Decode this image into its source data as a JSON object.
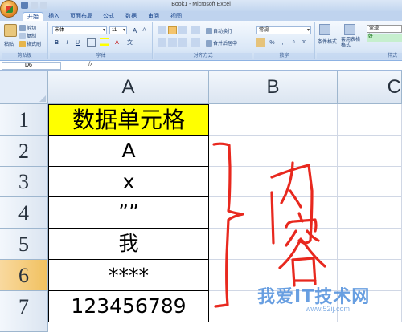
{
  "app": {
    "window_title": "Book1 - Microsoft Excel"
  },
  "tabs": [
    "开始",
    "插入",
    "页面布局",
    "公式",
    "数据",
    "审阅",
    "视图"
  ],
  "ribbon": {
    "clipboard": {
      "paste": "粘贴",
      "cut": "剪切",
      "copy": "复制",
      "format_painter": "格式刷",
      "label": "剪贴板"
    },
    "font": {
      "name": "宋体",
      "size": "11",
      "label": "字体",
      "bold": "B",
      "italic": "I",
      "underline": "U",
      "grow": "A",
      "shrink": "A",
      "wen": "文"
    },
    "alignment": {
      "wrap_text": "自动换行",
      "merge_center": "合并后居中",
      "label": "对齐方式"
    },
    "number": {
      "format": "常规",
      "label": "数字",
      "percent": "%",
      "comma": ",",
      "inc_decimal": ".0",
      "dec_decimal": ".00"
    },
    "styles": {
      "conditional": "条件格式",
      "table_format": "套用表格格式",
      "normal": "常规",
      "good": "好",
      "label": "样式"
    }
  },
  "formula_bar": {
    "name_box": "D6",
    "fx_label": "fx"
  },
  "grid": {
    "columns": [
      "A",
      "B",
      "C"
    ],
    "rows": [
      "1",
      "2",
      "3",
      "4",
      "5",
      "6",
      "7"
    ],
    "selected_row": "6",
    "cells_A": [
      "数据单元格",
      "A",
      "x",
      "””",
      "我",
      "****",
      "123456789"
    ],
    "header_fill": "#ffff00"
  },
  "annotation": {
    "handwritten_text": "内容",
    "color": "#e8281e"
  },
  "watermark": {
    "text": "我爱IT技术网",
    "url": "www.52ij.com"
  }
}
